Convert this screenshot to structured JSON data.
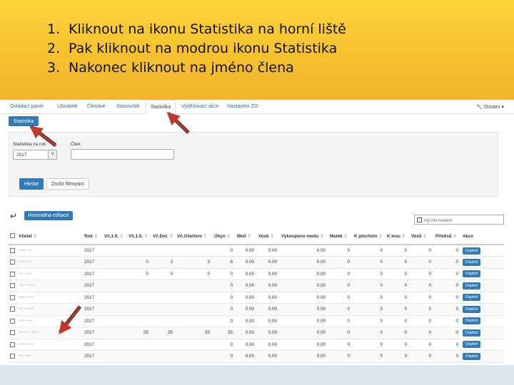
{
  "instructions": [
    {
      "num": "1.",
      "text": "Kliknout na ikonu Statistika na horní liště"
    },
    {
      "num": "2.",
      "text": "Pak kliknout na modrou ikonu Statistika"
    },
    {
      "num": "3.",
      "text": "Nakonec kliknout na jméno člena"
    }
  ],
  "nav": {
    "items": [
      "Ovládací panel",
      "Uživatelé",
      "Členové",
      "Stanoviště",
      "Statistika",
      "Vyděšovací akce",
      "Nastavení ZO"
    ],
    "right": "Ostatní"
  },
  "statistika_button": "Statistika",
  "filter": {
    "year_label": "Statistika za rok:",
    "year_value": "2017",
    "member_label": "Člen:",
    "search_button": "Hledat",
    "cancel_button": "Zrušit filtrování"
  },
  "bulk_button": "Hromadná editace",
  "quick_search_placeholder": "Rychlé hledání",
  "table": {
    "headers": [
      "Včelař",
      "Rok",
      "Vč.1.9.",
      "Vč.1.5.",
      "Vč.Dot.",
      "Vč.Ošetření",
      "Úhyn",
      "Med",
      "Vosk",
      "Vykoupeno medu",
      "Matek",
      "K plochóm",
      "K lesu",
      "Vozů",
      "Přívěsů",
      "Akce"
    ],
    "action_label": "Doplnit",
    "rows": [
      {
        "name": "••••• •••",
        "rok": "2017",
        "c": [
          "",
          "",
          "",
          "",
          "0",
          "0,00",
          "0,00",
          "0,00",
          "0",
          "0",
          "0",
          "0",
          "0"
        ]
      },
      {
        "name": "•••• ••••",
        "rok": "2017",
        "c": [
          "0",
          "3",
          "3",
          "6",
          "0,00",
          "0,00",
          "0,00",
          "0",
          "0",
          "0",
          "0",
          "0"
        ]
      },
      {
        "name": "••• •••••",
        "rok": "2017",
        "c": [
          "0",
          "0",
          "0",
          "0",
          "0,00",
          "0,00",
          "0,00",
          "0",
          "0",
          "0",
          "0",
          "0"
        ]
      },
      {
        "name": "•••• ••••••",
        "rok": "2017",
        "c": [
          "",
          "",
          "",
          "0",
          "0,00",
          "0,00",
          "0,00",
          "0",
          "0",
          "0",
          "0",
          "0"
        ]
      },
      {
        "name": "•••• •••••",
        "rok": "2017",
        "c": [
          "",
          "",
          "",
          "0",
          "0,00",
          "0,00",
          "0,00",
          "0",
          "0",
          "0",
          "0",
          "0"
        ]
      },
      {
        "name": "••• ••••••",
        "rok": "2017",
        "c": [
          "",
          "",
          "",
          "0",
          "0,00",
          "0,00",
          "0,00",
          "0",
          "0",
          "0",
          "0",
          "0"
        ]
      },
      {
        "name": "•••• ••••",
        "rok": "2017",
        "c": [
          "",
          "",
          "",
          "0",
          "0,00",
          "0,00",
          "0,00",
          "0",
          "0",
          "0",
          "0",
          "0"
        ]
      },
      {
        "name": "••••••• •••••",
        "rok": "2017",
        "c": [
          "35",
          "35",
          "35",
          "35",
          "0,00",
          "0,00",
          "0,00",
          "0",
          "0",
          "0",
          "0",
          "0"
        ]
      },
      {
        "name": "•••• •••••",
        "rok": "2017",
        "c": [
          "",
          "",
          "",
          "0",
          "0,00",
          "0,00",
          "0,00",
          "0",
          "0",
          "0",
          "0",
          "0"
        ]
      },
      {
        "name": "••• ••••",
        "rok": "2017",
        "c": [
          "",
          "",
          "",
          "0",
          "0,00",
          "0,00",
          "0,00",
          "0",
          "0",
          "0",
          "0",
          "0"
        ]
      }
    ]
  },
  "colors": {
    "accent": "#337ab7",
    "banner": "#f6c12e",
    "arrow": "#c0392b"
  }
}
